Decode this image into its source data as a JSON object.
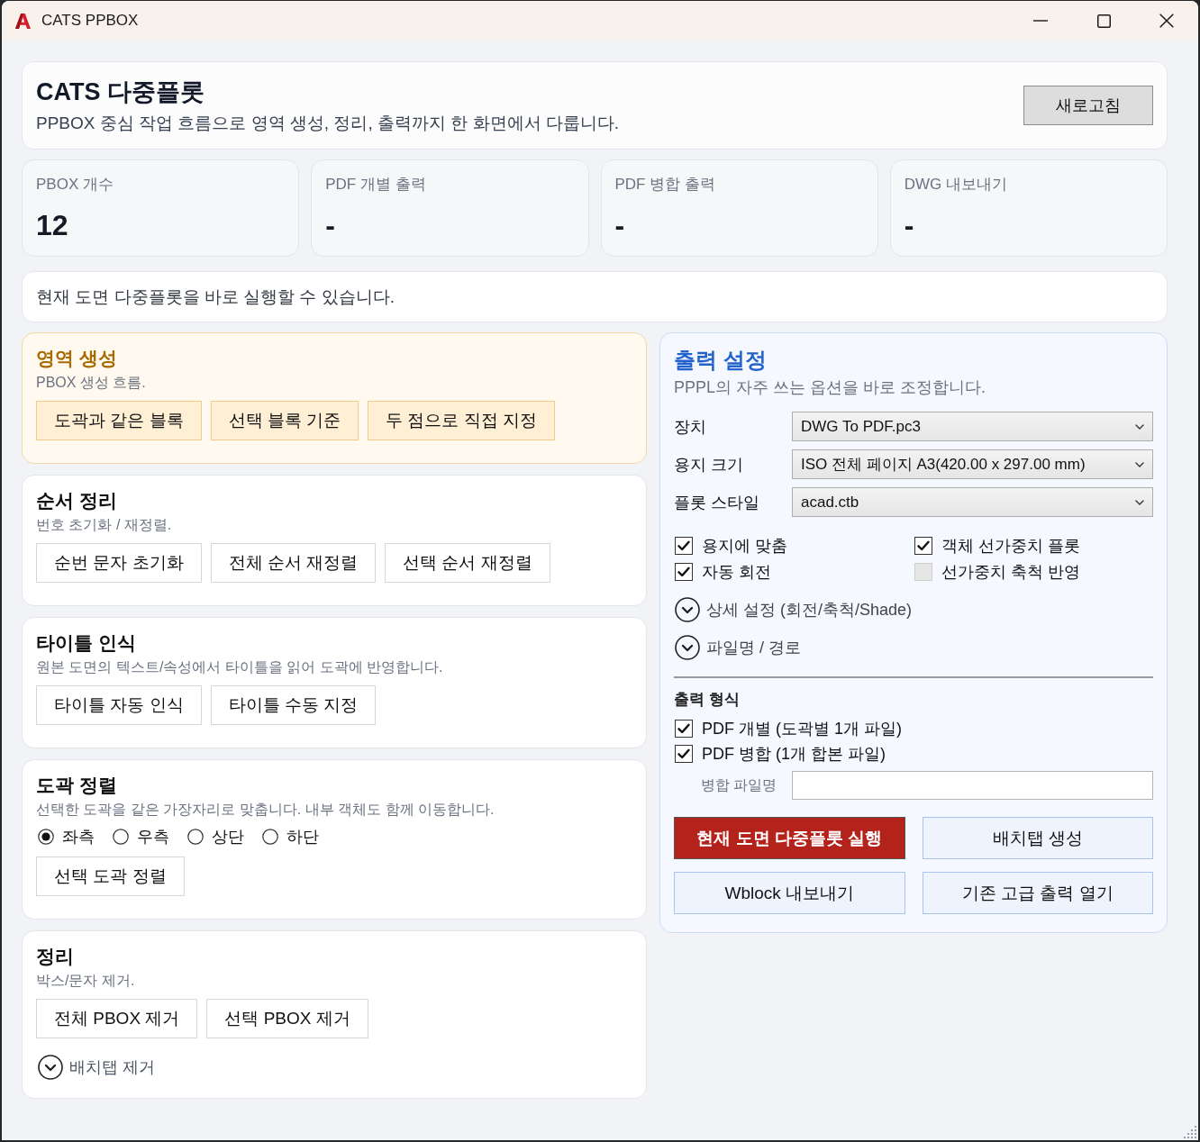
{
  "window": {
    "title": "CATS PPBOX"
  },
  "header": {
    "title": "CATS 다중플롯",
    "subtitle": "PPBOX 중심 작업 흐름으로 영역 생성, 정리, 출력까지 한 화면에서 다룹니다.",
    "refresh_button": "새로고침"
  },
  "stats": [
    {
      "label": "PBOX 개수",
      "value": "12"
    },
    {
      "label": "PDF 개별 출력",
      "value": "-"
    },
    {
      "label": "PDF 병합 출력",
      "value": "-"
    },
    {
      "label": "DWG 내보내기",
      "value": "-"
    }
  ],
  "status_message": "현재 도면 다중플롯을 바로 실행할 수 있습니다.",
  "sections": [
    {
      "kind": "accent",
      "title": "영역 생성",
      "description": "PBOX 생성 흐름.",
      "buttons": [
        "도곽과 같은 블록",
        "선택 블록 기준",
        "두 점으로 직접 지정"
      ]
    },
    {
      "kind": "plain",
      "title": "순서 정리",
      "description": "번호 초기화 / 재정렬.",
      "buttons": [
        "순번 문자 초기화",
        "전체 순서 재정렬",
        "선택 순서 재정렬"
      ]
    },
    {
      "kind": "plain",
      "title": "타이틀 인식",
      "description": "원본 도면의 텍스트/속성에서 타이틀을 읽어 도곽에 반영합니다.",
      "buttons": [
        "타이틀 자동 인식",
        "타이틀 수동 지정"
      ]
    },
    {
      "kind": "plain",
      "title": "도곽 정렬",
      "description": "선택한 도곽을 같은 가장자리로 맞춥니다. 내부 객체도 함께 이동합니다.",
      "radios": [
        {
          "label": "좌측",
          "selected": true
        },
        {
          "label": "우측",
          "selected": false
        },
        {
          "label": "상단",
          "selected": false
        },
        {
          "label": "하단",
          "selected": false
        }
      ],
      "buttons": [
        "선택 도곽 정렬"
      ]
    },
    {
      "kind": "plain",
      "title": "정리",
      "description": "박스/문자 제거.",
      "buttons": [
        "전체 PBOX 제거",
        "선택 PBOX 제거"
      ],
      "expanders": [
        {
          "label": "배치탭 제거",
          "expanded": false
        }
      ]
    }
  ],
  "output_settings": {
    "title": "출력 설정",
    "subtitle": "PPPL의 자주 쓰는 옵션을 바로 조정합니다.",
    "fields": [
      {
        "label": "장치",
        "value": "DWG To PDF.pc3"
      },
      {
        "label": "용지 크기",
        "value": "ISO 전체 페이지 A3(420.00 x 297.00 mm)"
      },
      {
        "label": "플롯 스타일",
        "value": "acad.ctb"
      }
    ],
    "options": [
      {
        "label": "용지에 맞춤",
        "checked": true
      },
      {
        "label": "객체 선가중치 플롯",
        "checked": true
      },
      {
        "label": "자동 회전",
        "checked": true
      },
      {
        "label": "선가중치 축척 반영",
        "checked": false
      }
    ],
    "expanders": [
      {
        "label": "상세 설정 (회전/축척/Shade)",
        "expanded": false
      },
      {
        "label": "파일명 / 경로",
        "expanded": false
      }
    ],
    "format_title": "출력 형식",
    "formats": [
      {
        "label": "PDF 개별 (도곽별 1개 파일)",
        "checked": true
      },
      {
        "label": "PDF 병합 (1개 합본 파일)",
        "checked": true
      }
    ],
    "merge_field": {
      "label": "병합 파일명"
    },
    "actions": [
      {
        "label": "현재 도면 다중플롯 실행",
        "kind": "primary"
      },
      {
        "label": "배치탭 생성",
        "kind": "secondary"
      },
      {
        "label": "Wblock 내보내기",
        "kind": "secondary"
      },
      {
        "label": "기존 고급 출력 열기",
        "kind": "secondary"
      }
    ]
  }
}
